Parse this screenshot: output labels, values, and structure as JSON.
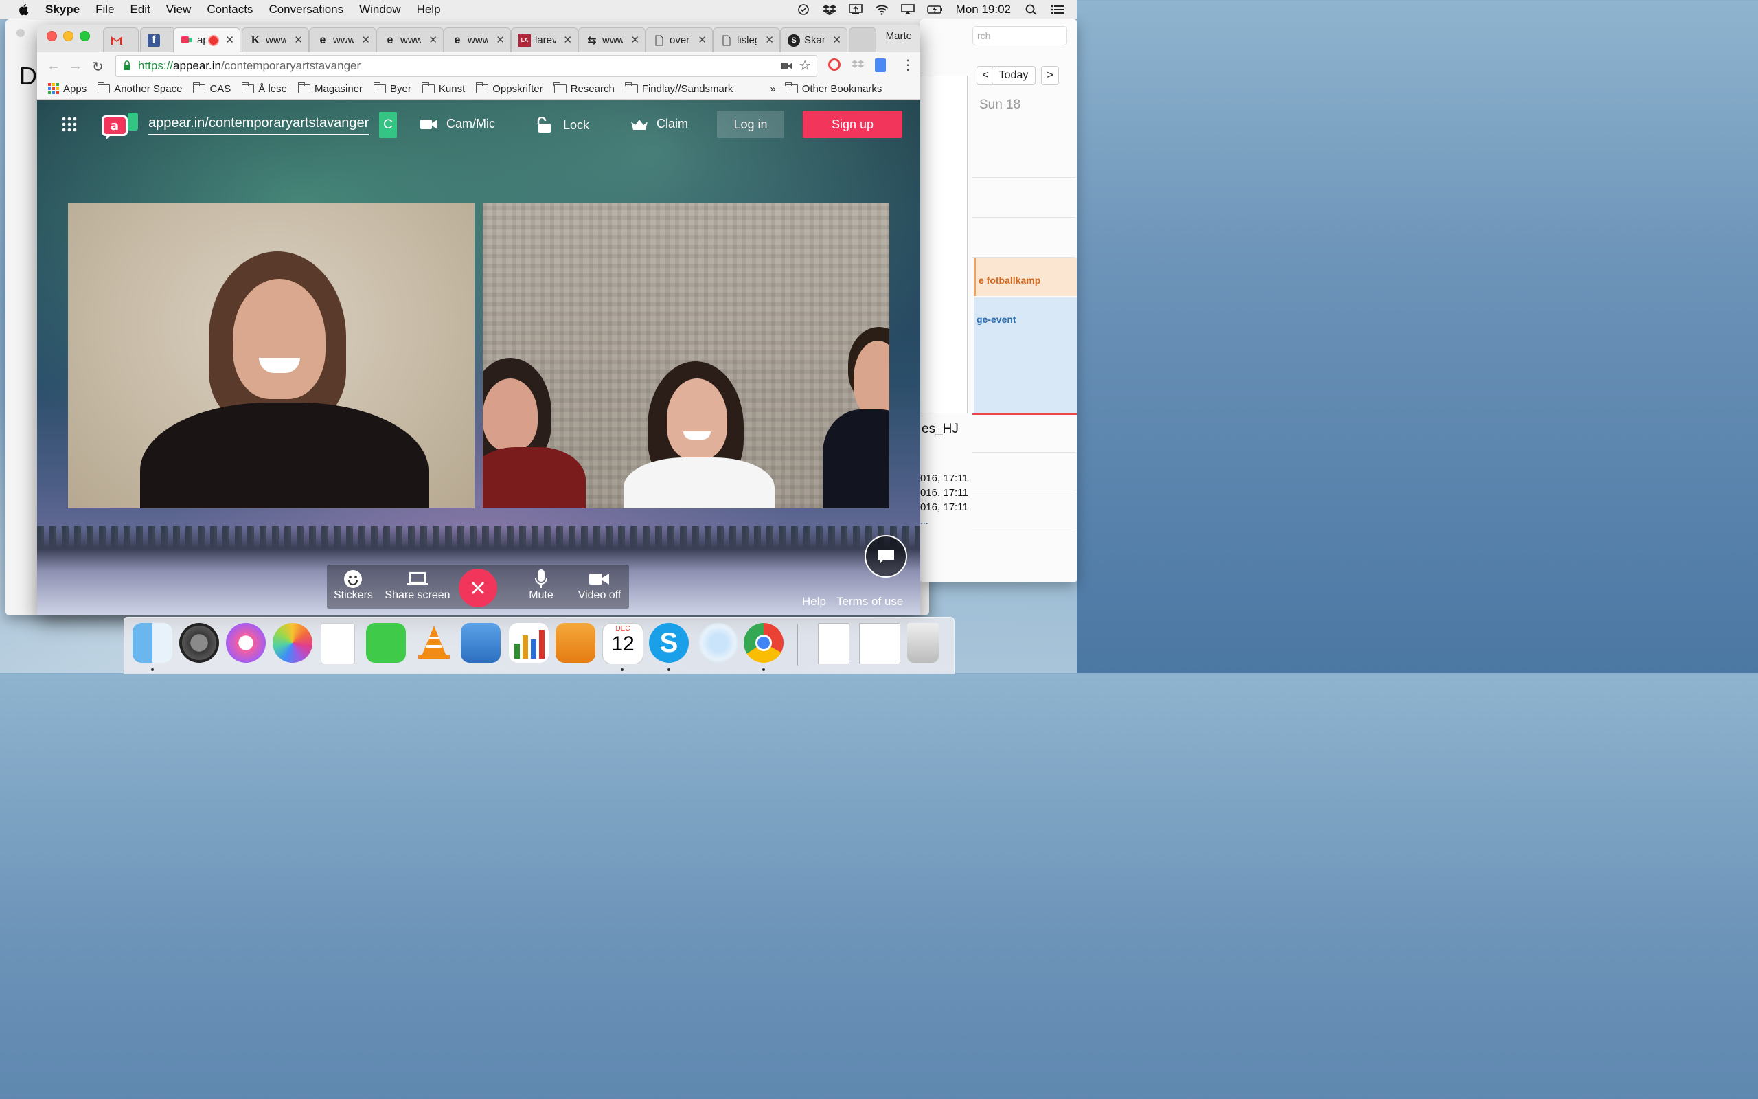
{
  "menubar": {
    "app": "Skype",
    "items": [
      "File",
      "Edit",
      "View",
      "Contacts",
      "Conversations",
      "Window",
      "Help"
    ],
    "clock": "Mon 19:02"
  },
  "browser": {
    "profile": "Marte",
    "tabs": [
      {
        "icon": "gmail-icon",
        "title": ""
      },
      {
        "icon": "facebook-icon",
        "title": ""
      },
      {
        "icon": "appear-in-icon",
        "title": "ap"
      },
      {
        "icon": "k-icon",
        "title": "www"
      },
      {
        "icon": "e-icon",
        "title": "www"
      },
      {
        "icon": "e-icon",
        "title": "www"
      },
      {
        "icon": "e-icon",
        "title": "www"
      },
      {
        "icon": "larb-icon",
        "title": "larev"
      },
      {
        "icon": "transfer-icon",
        "title": "www"
      },
      {
        "icon": "doc-icon",
        "title": "over"
      },
      {
        "icon": "doc-icon",
        "title": "lisleg"
      },
      {
        "icon": "circle-icon",
        "title": "Skan"
      }
    ],
    "url": {
      "proto": "https://",
      "host": "appear.in",
      "path": "/contemporaryartstavanger"
    },
    "bookmarks": {
      "apps": "Apps",
      "items": [
        "Another Space",
        "CAS",
        "Å lese",
        "Magasiner",
        "Byer",
        "Kunst",
        "Oppskrifter",
        "Research",
        "Findlay//Sandsmark"
      ],
      "overflow": "»",
      "other": "Other Bookmarks"
    }
  },
  "appear": {
    "room": "appear.in/contemporaryartstavanger",
    "green_btn": "C",
    "cam_mic": "Cam/Mic",
    "lock": "Lock",
    "claim": "Claim",
    "login": "Log in",
    "signup": "Sign up",
    "controls": {
      "stickers": "Stickers",
      "share": "Share screen",
      "mute": "Mute",
      "video_off": "Video off"
    },
    "help": "Help",
    "terms": "Terms of use"
  },
  "background_window": {
    "letter": "D"
  },
  "calendar": {
    "search_placeholder": "rch",
    "today": "Today",
    "prev": "<",
    "next": ">",
    "day": "Sun 18",
    "event1": "e fotballkamp",
    "event2": "ge-event",
    "file": "es_HJ",
    "dates": [
      "016, 17:11",
      "016, 17:11",
      "016, 17:11"
    ],
    "dots": "..."
  },
  "dock": {
    "calendar_month": "DEC",
    "calendar_day": "12"
  },
  "colors": {
    "signup": "#f2355b",
    "hangup": "#f2355b",
    "accent_green": "#34c585"
  }
}
